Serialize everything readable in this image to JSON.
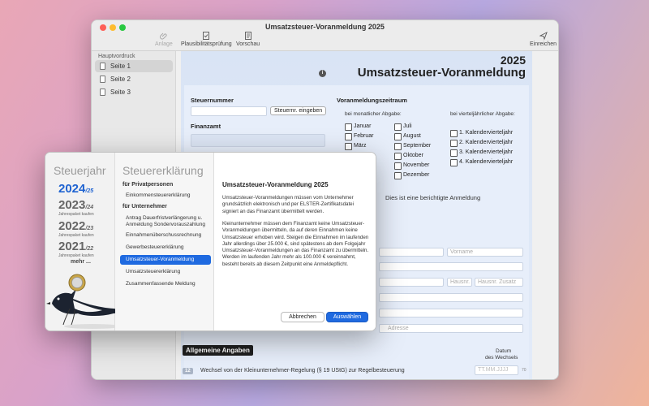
{
  "window": {
    "title": "Umsatzsteuer-Voranmeldung 2025"
  },
  "toolbar": {
    "attach": "Anlage",
    "check": "Plausibilitätsprüfung",
    "preview": "Vorschau",
    "submit": "Einreichen"
  },
  "sidebar": {
    "header": "Hauptvordruck",
    "items": [
      "Seite 1",
      "Seite 2",
      "Seite 3"
    ]
  },
  "form": {
    "year": "2025",
    "title": "Umsatzsteuer-Voranmeldung",
    "steuernummer_label": "Steuernummer",
    "steuernummer_button": "Steuernr. eingeben",
    "finanzamt_label": "Finanzamt",
    "zeitraum_label": "Voranmeldungszeitraum",
    "monthly_label": "bei monatlicher Abgabe:",
    "quarterly_label": "bei vierteljährlicher Abgabe:",
    "months_col1": [
      "Januar",
      "Februar",
      "März"
    ],
    "months_col2": [
      "Juli",
      "August",
      "September",
      "Oktober",
      "November",
      "Dezember"
    ],
    "quarters": [
      "1. Kalendervierteljahr",
      "2. Kalendervierteljahr",
      "3. Kalendervierteljahr",
      "4. Kalendervierteljahr"
    ],
    "berichtigt": "Dies ist eine berichtigte Anmeldung",
    "vorname_placeholder": "Vorname",
    "hausnr_placeholder": "Hausnr.",
    "hausnr_zusatz_placeholder": "Hausnr. Zusatz",
    "adresse_placeholder": "Adresse",
    "allgemeine_angaben": "Allgemeine Angaben",
    "datum_header": "Datum",
    "wechsel_header": "des Wechsels",
    "row12_num": "12",
    "row12_text": "Wechsel von der Kleinunternehmer-Regelung (§ 19 UStG) zur Regelbesteuerung",
    "row12_placeholder": "TT.MM.JJJJ",
    "row12_code": "70"
  },
  "dialog": {
    "col1_title": "Steuerjahr",
    "years": [
      {
        "year": "2024",
        "suffix": "/25",
        "sub": ""
      },
      {
        "year": "2023",
        "suffix": "/24",
        "sub": "Jahrespaket kaufen"
      },
      {
        "year": "2022",
        "suffix": "/23",
        "sub": "Jahrespaket kaufen"
      },
      {
        "year": "2021",
        "suffix": "/22",
        "sub": "Jahrespaket kaufen"
      }
    ],
    "more": "mehr ...",
    "col2_title": "Steuererklärung",
    "cat_private": "für Privatpersonen",
    "private_items": [
      "Einkommensteuererklärung"
    ],
    "cat_business": "für Unternehmer",
    "business_items": [
      "Antrag Dauerfristverlängerung u. Anmeldung Sondervorauszahlung",
      "Einnahmenüberschussrechnung",
      "Gewerbesteuererklärung",
      "Umsatzsteuer-Voranmeldung",
      "Umsatzsteuererklärung",
      "Zusammenfassende Meldung"
    ],
    "desc_title": "Umsatzsteuer-Voranmeldung 2025",
    "desc_p1": "Umsatzsteuer-Voranmeldungen müssen vom Unternehmer grundsätzlich elektronisch und per ELSTER-Zertifikatsdatei signiert an das Finanzamt übermittelt werden.",
    "desc_p2": "Kleinunternehmer müssen dem Finanzamt keine Umsatzsteuer-Voranmeldungen übermitteln, da auf deren Einnahmen keine Umsatzsteuer erhoben wird. Steigen die Einnahmen im laufenden Jahr allerdings über 25.000 €, sind spätestens ab dem Folgejahr Umsatzsteuer-Voranmeldungen an das Finanzamt zu übermitteln. Werden im laufenden Jahr mehr als 100.000 € vereinnahmt, besteht bereits ab diesem Zeitpunkt eine Anmeldepflicht.",
    "cancel": "Abbrechen",
    "ok": "Auswählen"
  },
  "colors": {
    "accent": "#1f6ae0",
    "form_bg": "#e3ebf8"
  }
}
